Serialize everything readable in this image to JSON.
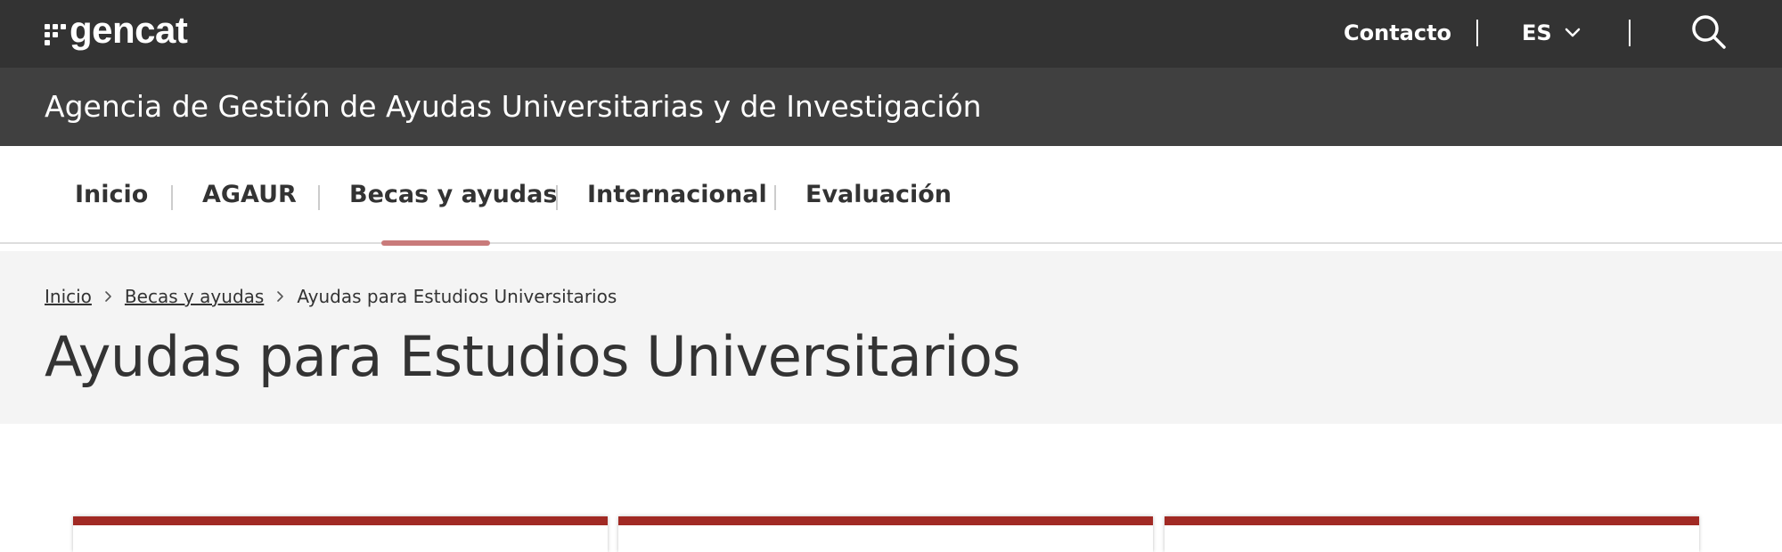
{
  "header": {
    "logo_text": "gencat",
    "contact_label": "Contacto",
    "language": "ES",
    "icons": {
      "search": "search-icon",
      "language_toggle": "chevron-down-icon"
    }
  },
  "agency": {
    "name": "Agencia de Gestión de Ayudas Universitarias y de Investigación"
  },
  "nav": {
    "items": [
      {
        "label": "Inicio"
      },
      {
        "label": "AGAUR"
      },
      {
        "label": "Becas y ayudas"
      },
      {
        "label": "Internacional"
      },
      {
        "label": "Evaluación"
      }
    ],
    "active_index": 2
  },
  "breadcrumb": {
    "items": [
      "Inicio",
      "Becas y ayudas",
      "Ayudas para Estudios Universitarios"
    ]
  },
  "page": {
    "title": "Ayudas para Estudios Universitarios"
  },
  "colors": {
    "topbar": "#333333",
    "agency_bar": "#404040",
    "active_underline": "#c97a7a",
    "card_accent": "#a12a24",
    "hero_background": "#f4f4f4"
  }
}
